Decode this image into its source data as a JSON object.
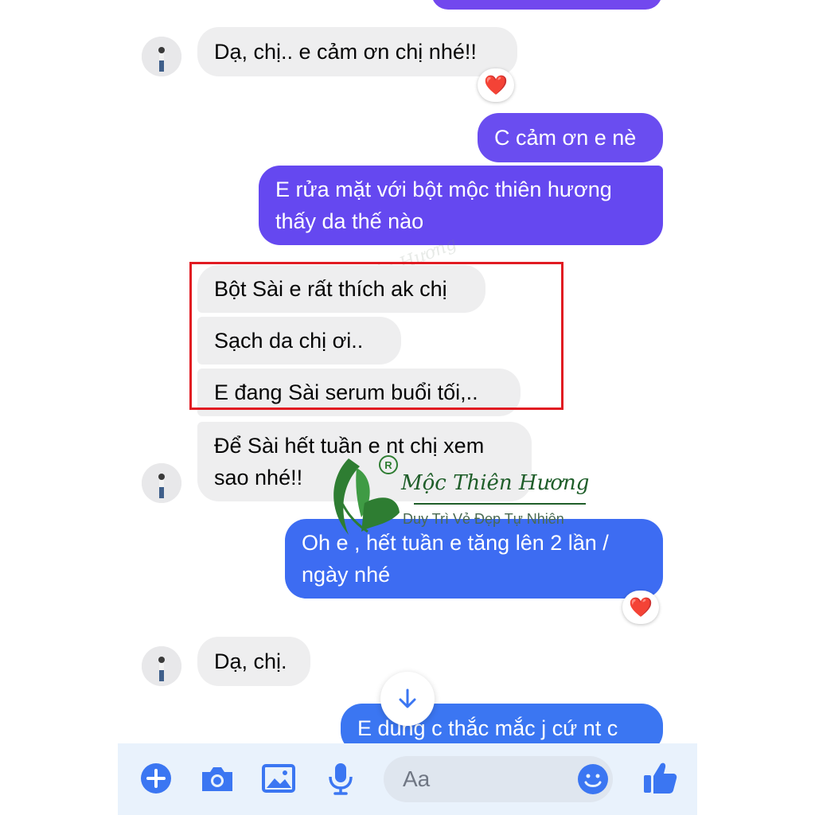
{
  "messages": [
    {
      "text": "Dạ, chị.. e cảm ơn chị nhé!!"
    },
    {
      "text": "C cảm ơn e nè"
    },
    {
      "text": "E rửa mặt với bột mộc thiên hương thấy da thế nào"
    },
    {
      "text": "Bột Sài e rất thích ak chị"
    },
    {
      "text": "Sạch da chị ơi.."
    },
    {
      "text": "E đang Sài serum buổi tối,.."
    },
    {
      "text": "Để Sài hết tuần e nt chị xem sao nhé!!"
    },
    {
      "text": "Oh e , hết tuần e tăng lên 2 lần / ngày nhé"
    },
    {
      "text": "Dạ, chị."
    },
    {
      "text": "E dùng c thắc mắc j cứ nt c"
    }
  ],
  "reactions": [
    {
      "emoji": "❤️"
    },
    {
      "emoji": "❤️"
    }
  ],
  "watermark": {
    "brand": "Mộc Thiên Hương",
    "tagline": "Duy Trì Vẻ Đẹp Tự Nhiên",
    "registered": "R"
  },
  "composer": {
    "placeholder": "Aa",
    "icons": [
      "plus-icon",
      "camera-icon",
      "image-icon",
      "microphone-icon",
      "emoji-icon",
      "thumbs-up-icon"
    ]
  },
  "colors": {
    "accent": "#3b76f2",
    "outgoing_purple": "#6a4df0",
    "outgoing_blue": "#3d6cf2",
    "incoming": "#eeeeef",
    "highlight": "#e11b22",
    "watermark_green": "#2e7d32"
  }
}
